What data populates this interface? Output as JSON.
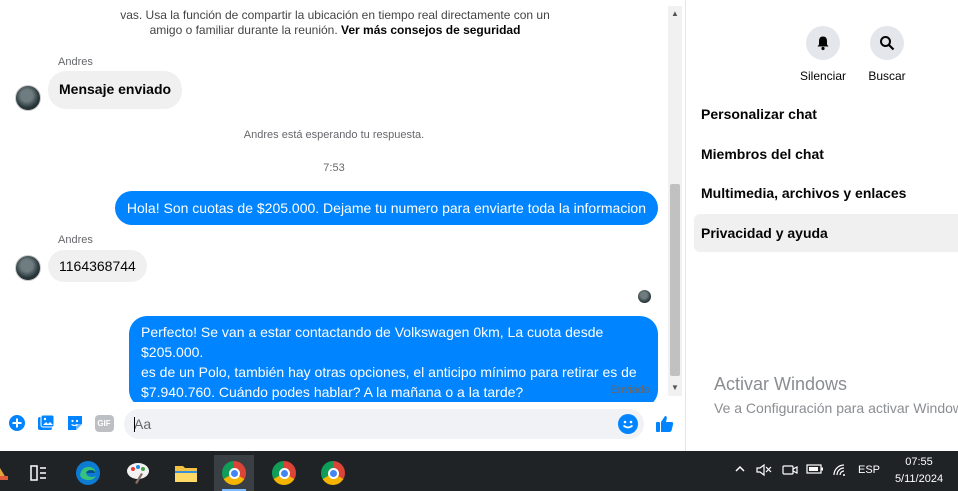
{
  "chat": {
    "safety_notice_line1": "vas. Usa la función de compartir la ubicación en tiempo real directamente con un",
    "safety_notice_line2_prefix": "amigo o familiar durante la reunión.",
    "safety_notice_link": "Ver más consejos de seguridad",
    "messages": [
      {
        "sender": "Andres",
        "text": "Mensaje enviado",
        "direction": "incoming"
      },
      {
        "system": "Andres está esperando tu respuesta."
      },
      {
        "time": "7:53"
      },
      {
        "text": "Hola! Son cuotas de $205.000. Dejame tu numero para enviarte toda la informacion",
        "direction": "outgoing"
      },
      {
        "sender": "Andres",
        "text": "1164368744",
        "direction": "incoming"
      },
      {
        "text_lines": [
          "Perfecto!  Se van a estar contactando de Volkswagen 0km, La cuota desde $205.000.",
          "es de un Polo, también hay otras opciones, el anticipo mínimo para retirar es de",
          "$7.940.760. Cuándo podes hablar? A la mañana o a la tarde?"
        ],
        "direction": "outgoing"
      }
    ],
    "sent_status": "Enviado"
  },
  "composer": {
    "placeholder": "Aa",
    "gif_label": "GIF"
  },
  "side": {
    "actions": [
      {
        "label": "Silenciar",
        "icon": "bell-icon"
      },
      {
        "label": "Buscar",
        "icon": "search-icon"
      }
    ],
    "menu": [
      {
        "label": "Personalizar chat"
      },
      {
        "label": "Miembros del chat"
      },
      {
        "label": "Multimedia, archivos y enlaces"
      },
      {
        "label": "Privacidad y ayuda",
        "active": true
      }
    ],
    "activate_title": "Activar Windows",
    "activate_sub": "Ve a Configuración para activar Windows."
  },
  "taskbar": {
    "language": "ESP",
    "time": "07:55",
    "date": "5/11/2024"
  },
  "colors": {
    "messenger_blue": "#0084ff",
    "taskbar_bg": "#1f2326"
  }
}
